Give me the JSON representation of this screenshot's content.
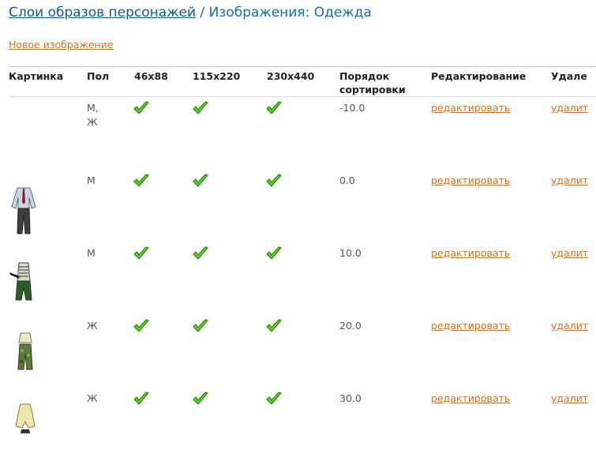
{
  "header": {
    "crumb": "Слои образов персонажей",
    "separator": " / ",
    "title": "Изображения: Одежда"
  },
  "actions": {
    "new_image": "Новое изображение"
  },
  "table": {
    "columns": {
      "picture": "Картинка",
      "gender": "Пол",
      "size_small": "46x88",
      "size_medium": "115x220",
      "size_large": "230x440",
      "sort_order_line1": "Порядок",
      "sort_order_line2": "сортировки",
      "edit": "Редактирование",
      "delete": "Удале"
    },
    "rows": [
      {
        "gender_line1": "М,",
        "gender_line2": "Ж",
        "sort": "-10.0",
        "edit": "редактировать",
        "delete": "удалит",
        "thumb": "none"
      },
      {
        "gender_line1": "М",
        "gender_line2": "",
        "sort": "0.0",
        "edit": "редактировать",
        "delete": "удалит",
        "thumb": "shirt-trousers-outfit-icon"
      },
      {
        "gender_line1": "М",
        "gender_line2": "",
        "sort": "10.0",
        "edit": "редактировать",
        "delete": "удалит",
        "thumb": "vest-gun-outfit-icon"
      },
      {
        "gender_line1": "Ж",
        "gender_line2": "",
        "sort": "20.0",
        "edit": "редактировать",
        "delete": "удалит",
        "thumb": "top-camo-pants-outfit-icon"
      },
      {
        "gender_line1": "Ж",
        "gender_line2": "",
        "sort": "30.0",
        "edit": "редактировать",
        "delete": "удалит",
        "thumb": "dress-outfit-icon"
      }
    ]
  },
  "colors": {
    "link": "#d0722a",
    "title": "#1b6f9a",
    "check": "#4cbf1f"
  }
}
